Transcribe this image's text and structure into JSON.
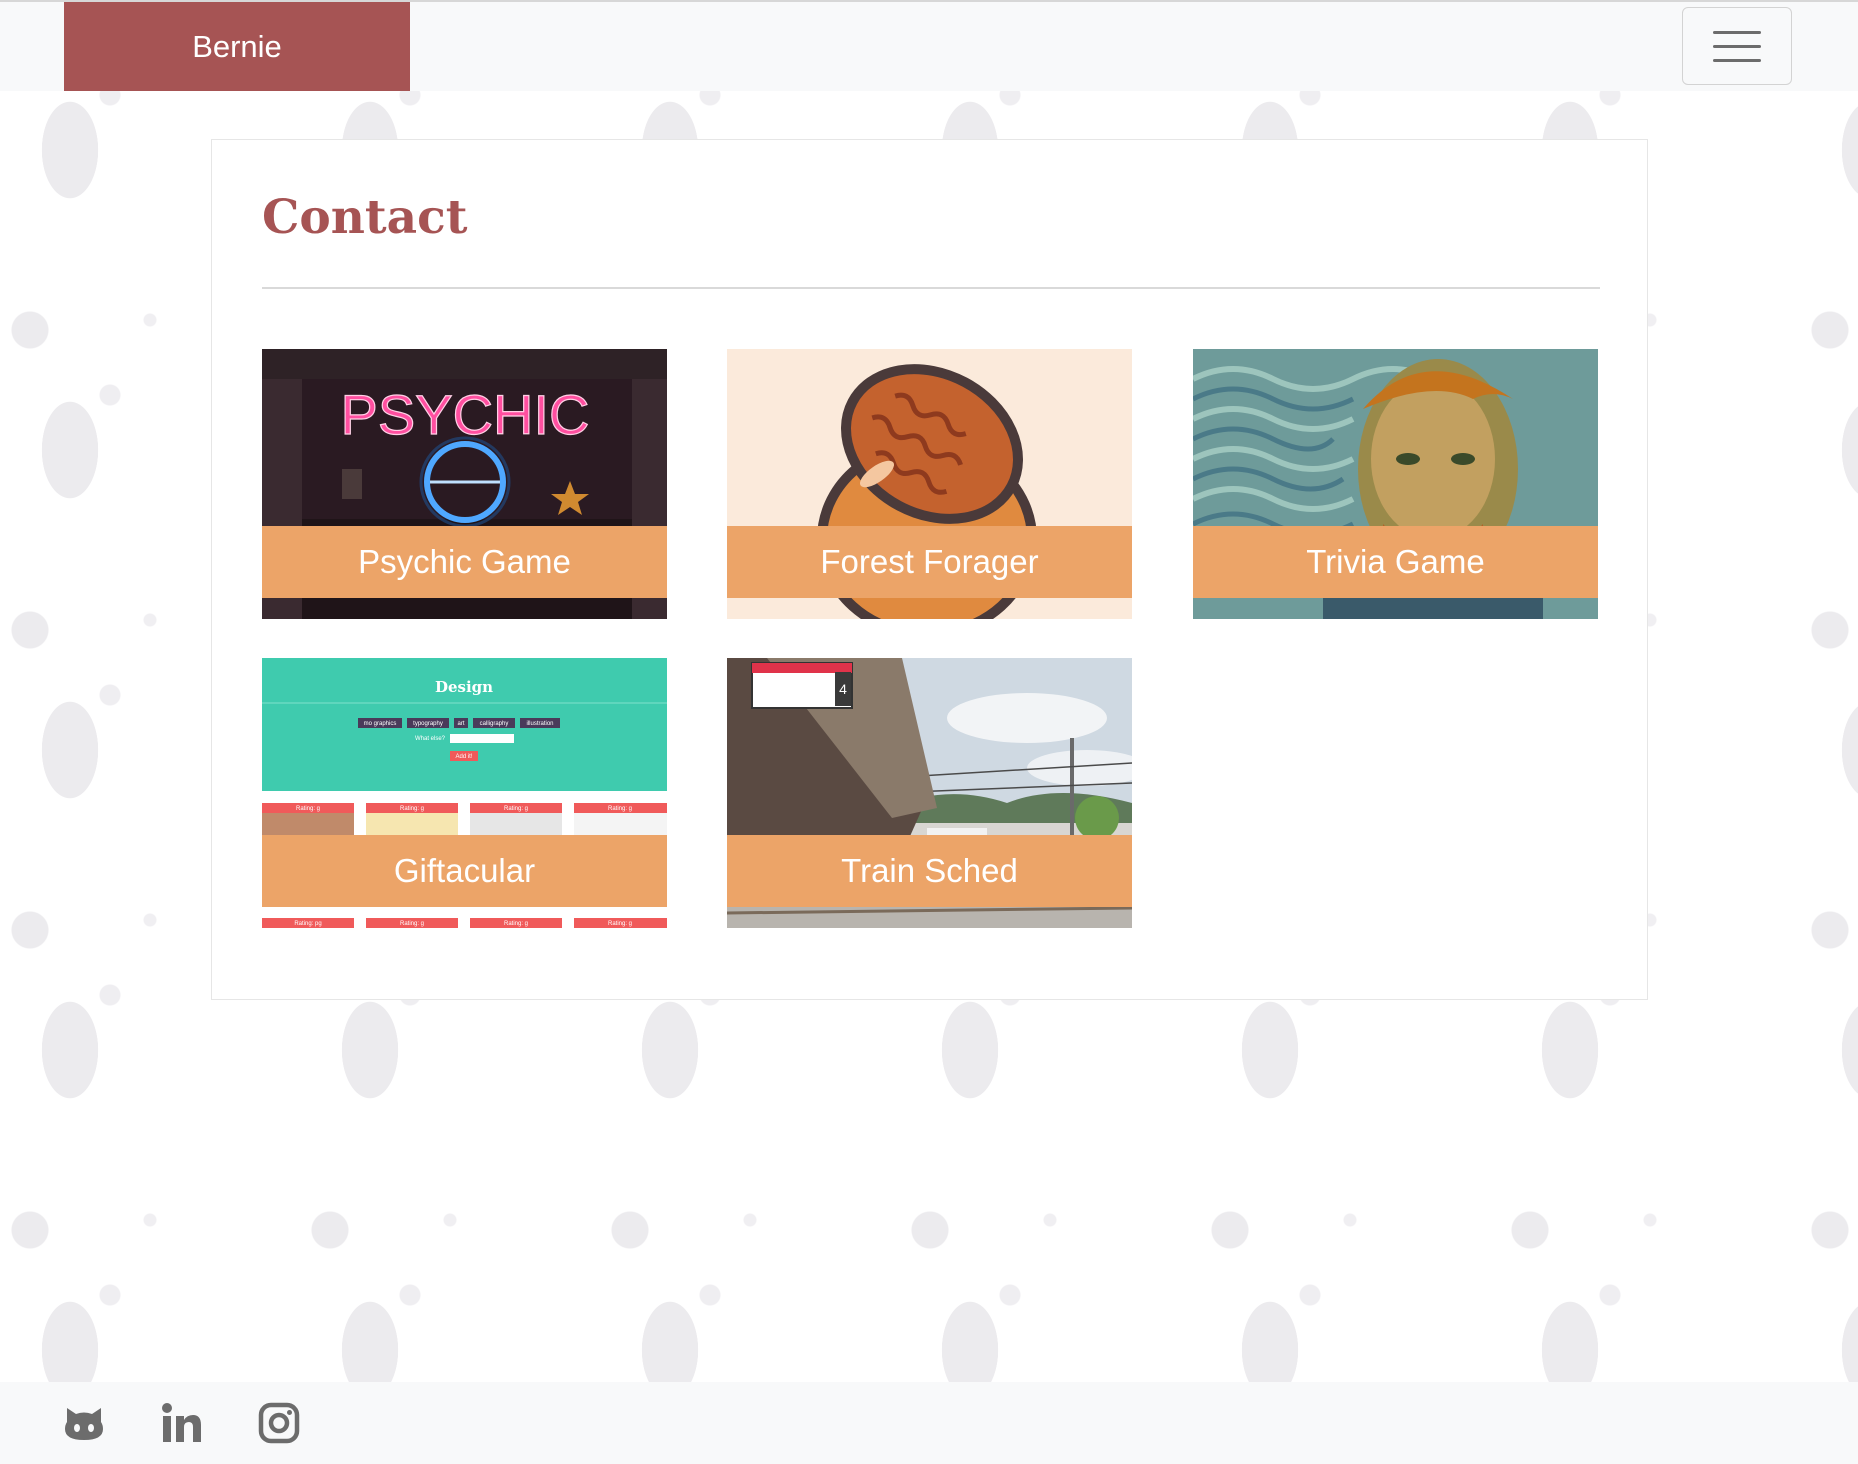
{
  "navbar": {
    "brand": "Bernie",
    "toggler_icon": "hamburger-menu-icon",
    "brand_color": "#a65454"
  },
  "main": {
    "title": "Contact",
    "projects": [
      {
        "label": "Psychic Game",
        "thumbnail": "neon-psychic-sign"
      },
      {
        "label": "Forest Forager",
        "thumbnail": "acorn-illustration"
      },
      {
        "label": "Trivia Game",
        "thumbnail": "van-gogh-self-portrait"
      },
      {
        "label": "Giftacular",
        "thumbnail": "design-gif-search-page"
      },
      {
        "label": "Train Sched",
        "thumbnail": "train-station-platform"
      }
    ],
    "thumbnail_text": {
      "psychic_sign": "PSYCHIC",
      "design_heading": "Design",
      "design_tags": [
        "mo graphics",
        "typography",
        "art",
        "calligraphy",
        "illustration"
      ],
      "design_prompt": "What else?",
      "design_button": "Add it!",
      "design_rating": "Rating: g",
      "design_rating_pg": "Rating: pg",
      "platform_number": "4"
    },
    "caption_color": "#eca468"
  },
  "footer": {
    "links": [
      {
        "icon": "github-icon"
      },
      {
        "icon": "linkedin-icon"
      },
      {
        "icon": "instagram-icon"
      }
    ]
  }
}
